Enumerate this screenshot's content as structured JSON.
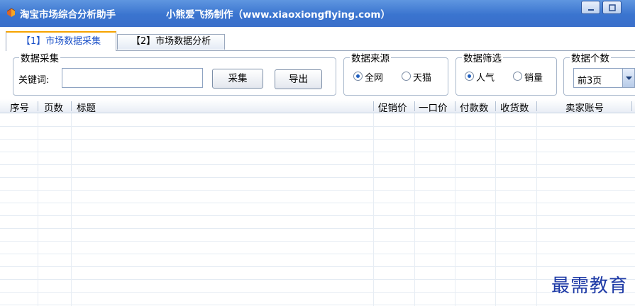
{
  "window": {
    "title": "淘宝市场综合分析助手",
    "subtitle": "小熊爱飞扬制作（www.xiaoxiongflying.com）"
  },
  "tabs": [
    {
      "label": "【1】市场数据采集",
      "active": true
    },
    {
      "label": "【2】市场数据分析",
      "active": false
    }
  ],
  "collect": {
    "group_label": "数据采集",
    "keyword_label": "关键词:",
    "keyword_value": "",
    "collect_button": "采集",
    "export_button": "导出"
  },
  "source": {
    "group_label": "数据来源",
    "options": [
      "全网",
      "天猫"
    ],
    "selected": "全网"
  },
  "filter": {
    "group_label": "数据筛选",
    "options": [
      "人气",
      "销量"
    ],
    "selected": "人气"
  },
  "count": {
    "group_label": "数据个数",
    "selected": "前3页"
  },
  "table": {
    "columns": [
      "序号",
      "页数",
      "标题",
      "促销价",
      "一口价",
      "付款数",
      "收货数",
      "卖家账号"
    ],
    "rows": []
  },
  "watermark": "最需教育",
  "colors": {
    "titlebar": "#3a74cf",
    "active_tab_text": "#1a50c8",
    "active_tab_accent": "#f6a300",
    "watermark": "#1e3aa6"
  }
}
